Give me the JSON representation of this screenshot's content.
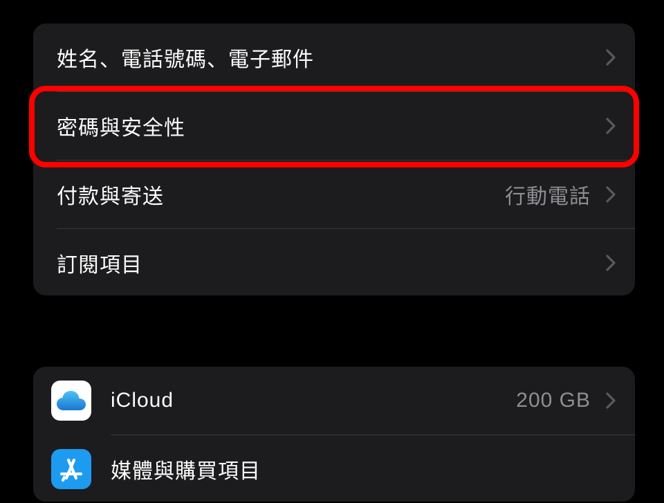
{
  "account_group": {
    "name_phone_email": {
      "label": "姓名、電話號碼、電子郵件"
    },
    "password_security": {
      "label": "密碼與安全性"
    },
    "payment_shipping": {
      "label": "付款與寄送",
      "detail": "行動電話"
    },
    "subscriptions": {
      "label": "訂閱項目"
    }
  },
  "services_group": {
    "icloud": {
      "label": "iCloud",
      "detail": "200 GB"
    },
    "media_purchases": {
      "label": "媒體與購買項目"
    }
  },
  "icons": {
    "icloud": "icloud-icon",
    "appstore": "appstore-icon",
    "chevron": "chevron-right-icon"
  },
  "highlight": {
    "target": "password_security"
  }
}
